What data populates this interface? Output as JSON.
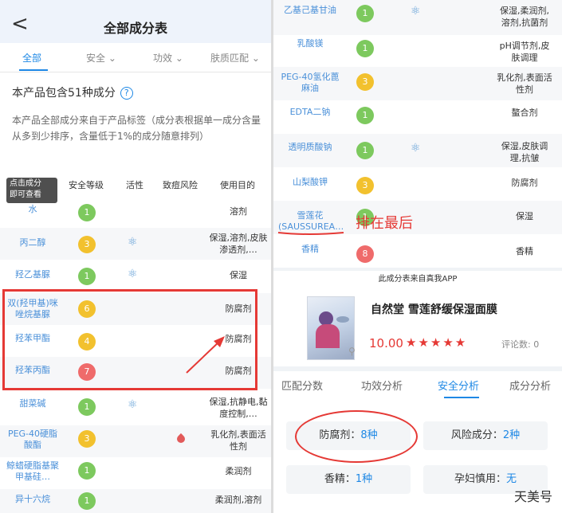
{
  "left": {
    "title": "全部成分表",
    "back": "<",
    "tabs": [
      "全部",
      "安全",
      "功效",
      "肤质匹配"
    ],
    "count_text": "本产品包含51种成分",
    "help": "?",
    "description": "本产品全部成分来自于产品标签（成分表根据单一成分含量从多到少排序，含量低于1%的成分随意排列）",
    "tooltip": "点击成分\n即可查看",
    "headers": [
      "",
      "安全等级",
      "活性",
      "致痘风险",
      "使用目的"
    ],
    "rows": [
      {
        "name": "水",
        "safety": "1",
        "color": "#7dc95e",
        "active": false,
        "acne": false,
        "purpose": "溶剂"
      },
      {
        "name": "丙二醇",
        "safety": "3",
        "color": "#f2c12e",
        "active": true,
        "acne": false,
        "purpose": "保湿,溶剂,皮肤渗透剂,…"
      },
      {
        "name": "羟乙基脲",
        "safety": "1",
        "color": "#7dc95e",
        "active": true,
        "acne": false,
        "purpose": "保湿"
      },
      {
        "name": "双(羟甲基)咪唑烷基脲",
        "safety": "6",
        "color": "#f2c12e",
        "active": false,
        "acne": false,
        "purpose": "防腐剂"
      },
      {
        "name": "羟苯甲酯",
        "safety": "4",
        "color": "#f2c12e",
        "active": false,
        "acne": false,
        "purpose": "防腐剂"
      },
      {
        "name": "羟苯丙酯",
        "safety": "7",
        "color": "#ef6b6b",
        "active": false,
        "acne": false,
        "purpose": "防腐剂"
      },
      {
        "name": "甜菜碱",
        "safety": "1",
        "color": "#7dc95e",
        "active": true,
        "acne": false,
        "purpose": "保湿,抗静电,黏度控制,…"
      },
      {
        "name": "PEG-40硬脂酸酯",
        "safety": "3",
        "color": "#f2c12e",
        "active": false,
        "acne": true,
        "purpose": "乳化剂,表面活性剂"
      },
      {
        "name": "鲸蜡硬脂基聚甲基硅…",
        "safety": "1",
        "color": "#7dc95e",
        "active": false,
        "acne": false,
        "purpose": "柔润剂"
      },
      {
        "name": "异十六烷",
        "safety": "1",
        "color": "#7dc95e",
        "active": false,
        "acne": false,
        "purpose": "柔润剂,溶剂"
      }
    ]
  },
  "right": {
    "rows": [
      {
        "name": "乙基己基甘油",
        "safety": "1",
        "color": "#7dc95e",
        "active": true,
        "purpose": "保湿,柔润剂,溶剂,抗菌剂"
      },
      {
        "name": "乳酸镁",
        "safety": "1",
        "color": "#7dc95e",
        "active": false,
        "purpose": "pH调节剂,皮肤调理"
      },
      {
        "name": "PEG-40氢化蓖麻油",
        "safety": "3",
        "color": "#f2c12e",
        "active": false,
        "purpose": "乳化剂,表面活性剂"
      },
      {
        "name": "EDTA二钠",
        "safety": "1",
        "color": "#7dc95e",
        "active": false,
        "purpose": "螯合剂"
      },
      {
        "name": "透明质酸钠",
        "safety": "1",
        "color": "#7dc95e",
        "active": true,
        "purpose": "保湿,皮肤调理,抗皱"
      },
      {
        "name": "山梨酸钾",
        "safety": "3",
        "color": "#f2c12e",
        "active": false,
        "purpose": "防腐剂"
      },
      {
        "name": "雪莲花(SAUSSUREA…",
        "safety": "1",
        "color": "#7dc95e",
        "active": false,
        "purpose": "保湿"
      },
      {
        "name": "香精",
        "safety": "8",
        "color": "#ef6b6b",
        "active": false,
        "purpose": "香精"
      }
    ],
    "annotation": "排在最后",
    "source": "此成分表来自真我APP",
    "product": {
      "name": "自然堂 雪莲舒缓保湿面膜",
      "score": "10.00",
      "stars": "★★★★★",
      "reviews": "评论数: 0"
    },
    "tabs": [
      "匹配分数",
      "功效分析",
      "安全分析",
      "成分分析"
    ],
    "stats": [
      {
        "label": "防腐剂：",
        "value": "8种"
      },
      {
        "label": "风险成分：",
        "value": "2种"
      },
      {
        "label": "香精：",
        "value": "1种"
      },
      {
        "label": "孕妇慎用：",
        "value": "无"
      }
    ],
    "watermark": "天美号"
  }
}
